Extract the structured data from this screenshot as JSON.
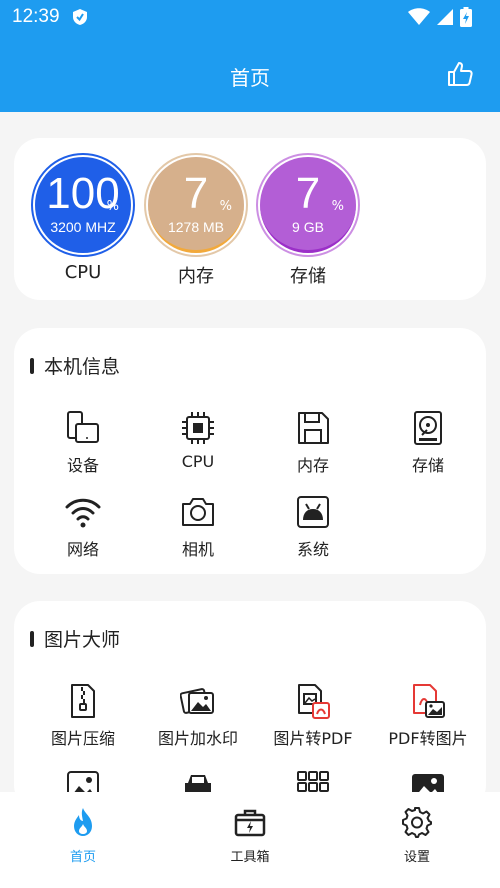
{
  "status_bar": {
    "time": "12:39"
  },
  "app_bar": {
    "title": "首页"
  },
  "stats": [
    {
      "value": "100",
      "unit": "%",
      "detail": "3200 MHZ",
      "label": "CPU",
      "color": "#1f5fe8"
    },
    {
      "value": "7",
      "unit": "%",
      "detail": "1278 MB",
      "label": "内存",
      "color": "#d6b08c"
    },
    {
      "value": "7",
      "unit": "%",
      "detail": "9 GB",
      "label": "存储",
      "color": "#b35ed6"
    }
  ],
  "device_info": {
    "title": "本机信息",
    "items": [
      {
        "label": "设备",
        "icon": "device-icon"
      },
      {
        "label": "CPU",
        "icon": "cpu-chip-icon"
      },
      {
        "label": "内存",
        "icon": "memory-save-icon"
      },
      {
        "label": "存储",
        "icon": "hard-drive-icon"
      },
      {
        "label": "网络",
        "icon": "wifi-icon"
      },
      {
        "label": "相机",
        "icon": "camera-icon"
      },
      {
        "label": "系统",
        "icon": "android-icon"
      }
    ]
  },
  "picture_master": {
    "title": "图片大师",
    "items": [
      {
        "label": "图片压缩",
        "icon": "zip-file-icon"
      },
      {
        "label": "图片加水印",
        "icon": "image-stack-icon"
      },
      {
        "label": "图片转PDF",
        "icon": "image-to-pdf-icon"
      },
      {
        "label": "PDF转图片",
        "icon": "pdf-to-image-icon"
      }
    ]
  },
  "bottom_nav": {
    "items": [
      {
        "label": "首页",
        "icon": "flame-icon",
        "active": true
      },
      {
        "label": "工具箱",
        "icon": "toolbox-icon",
        "active": false
      },
      {
        "label": "设置",
        "icon": "gear-icon",
        "active": false
      }
    ]
  },
  "colors": {
    "primary": "#1e9cf0",
    "background": "#f5f5f5"
  }
}
